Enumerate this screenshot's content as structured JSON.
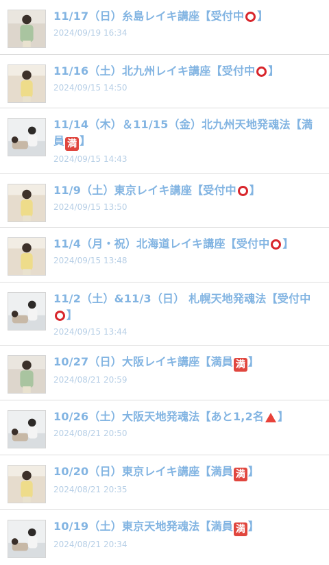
{
  "entries": [
    {
      "title_main": "11/17（日）糸島レイキ講座【受付中",
      "status": "circle",
      "title_tail": "】",
      "date": "2024/09/19 16:34",
      "thumb": "man-standing-1"
    },
    {
      "title_main": "11/16（土）北九州レイキ講座【受付中",
      "status": "circle",
      "title_tail": "】",
      "date": "2024/09/15 14:50",
      "thumb": "man-standing-2"
    },
    {
      "title_main": "11/14（木）＆11/15（金）北九州天地発魂法【満員",
      "status": "full",
      "title_tail": "】",
      "date": "2024/09/15 14:43",
      "thumb": "man-treatment"
    },
    {
      "title_main": "11/9（土）東京レイキ講座【受付中",
      "status": "circle",
      "title_tail": "】",
      "date": "2024/09/15 13:50",
      "thumb": "man-standing-2"
    },
    {
      "title_main": "11/4（月・祝）北海道レイキ講座【受付中",
      "status": "circle",
      "title_tail": "】",
      "date": "2024/09/15 13:48",
      "thumb": "man-standing-2"
    },
    {
      "title_main": "11/2（土）&11/3（日） 札幌天地発魂法【受付中",
      "status": "circle",
      "title_tail": "】",
      "date": "2024/09/15 13:44",
      "thumb": "man-treatment"
    },
    {
      "title_main": "10/27（日）大阪レイキ講座【満員",
      "status": "full",
      "title_tail": "】",
      "date": "2024/08/21 20:59",
      "thumb": "man-standing-1"
    },
    {
      "title_main": "10/26（土）大阪天地発魂法【あと1,2名",
      "status": "triangle",
      "title_tail": "】",
      "date": "2024/08/21 20:50",
      "thumb": "man-treatment"
    },
    {
      "title_main": "10/20（日）東京レイキ講座【満員",
      "status": "full",
      "title_tail": "】",
      "date": "2024/08/21 20:35",
      "thumb": "man-standing-2"
    },
    {
      "title_main": "10/19（土）東京天地発魂法【満員",
      "status": "full",
      "title_tail": "】",
      "date": "2024/08/21 20:34",
      "thumb": "man-treatment"
    }
  ],
  "full_label": "満",
  "colors": {
    "title": "#82b4e2",
    "date": "#b7cfe6",
    "circle": "#d8262c",
    "full_badge": "#e0463e",
    "triangle": "#e8423a"
  }
}
